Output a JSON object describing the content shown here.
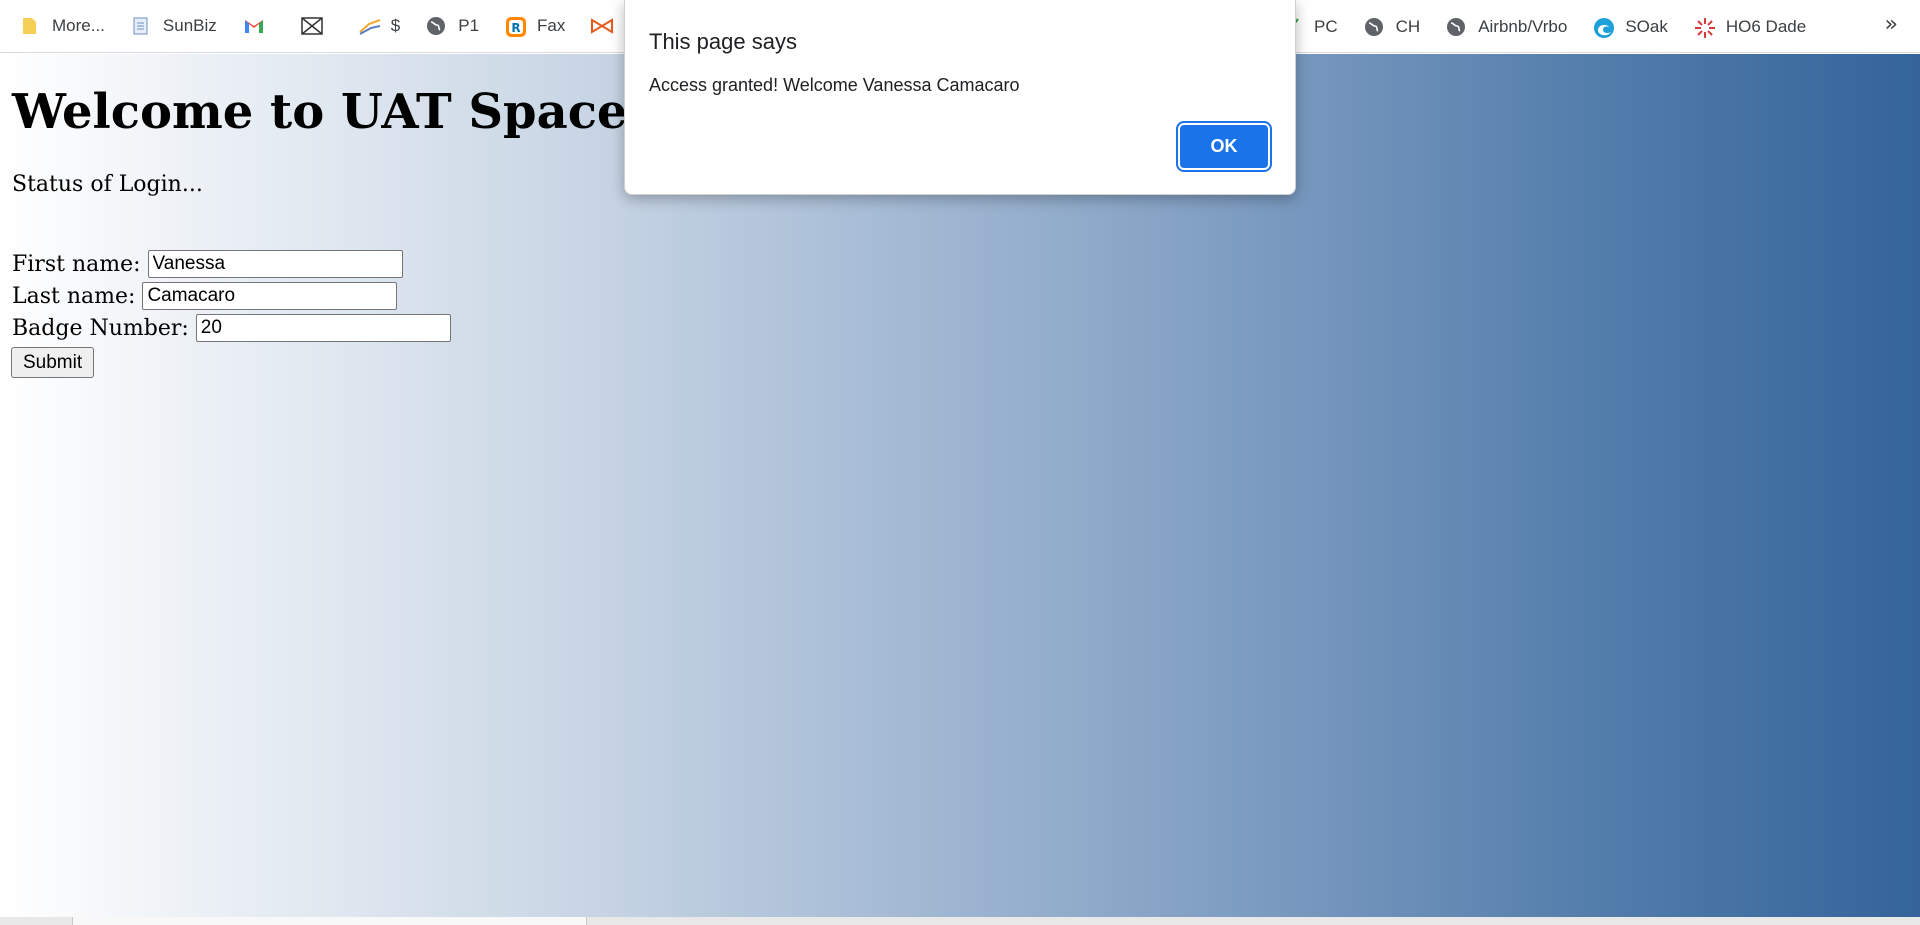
{
  "bookmarks": {
    "items": [
      {
        "label": "More...",
        "icon": "folder-icon"
      },
      {
        "label": "SunBiz",
        "icon": "document-icon"
      },
      {
        "label": "",
        "icon": "gmail-icon"
      },
      {
        "label": "",
        "icon": "network-icon"
      },
      {
        "label": "$",
        "icon": "chart-icon"
      },
      {
        "label": "P1",
        "icon": "globe-icon"
      },
      {
        "label": "Fax",
        "icon": "ringcentral-icon"
      },
      {
        "label": "",
        "icon": "bowtie-icon"
      }
    ],
    "right_items": [
      {
        "label": "PC",
        "icon": "check-icon"
      },
      {
        "label": "CH",
        "icon": "globe-icon"
      },
      {
        "label": "Airbnb/Vrbo",
        "icon": "globe-icon"
      },
      {
        "label": "SOak",
        "icon": "edge-icon"
      },
      {
        "label": "HO6 Dade",
        "icon": "starburst-icon"
      }
    ],
    "overflow": "»"
  },
  "page": {
    "title": "Welcome to UAT Space Login",
    "status": "Status of Login...",
    "form": {
      "first_name_label": "First name:",
      "first_name_value": "Vanessa",
      "last_name_label": "Last name:",
      "last_name_value": "Camacaro",
      "badge_label": "Badge Number:",
      "badge_value": "20",
      "submit_label": "Submit"
    }
  },
  "dialog": {
    "title": "This page says",
    "message": "Access granted! Welcome Vanessa Camacaro",
    "ok_label": "OK"
  },
  "colors": {
    "accent": "#1a73e8",
    "gradient_start": "#ffffff",
    "gradient_end": "#35649a"
  }
}
